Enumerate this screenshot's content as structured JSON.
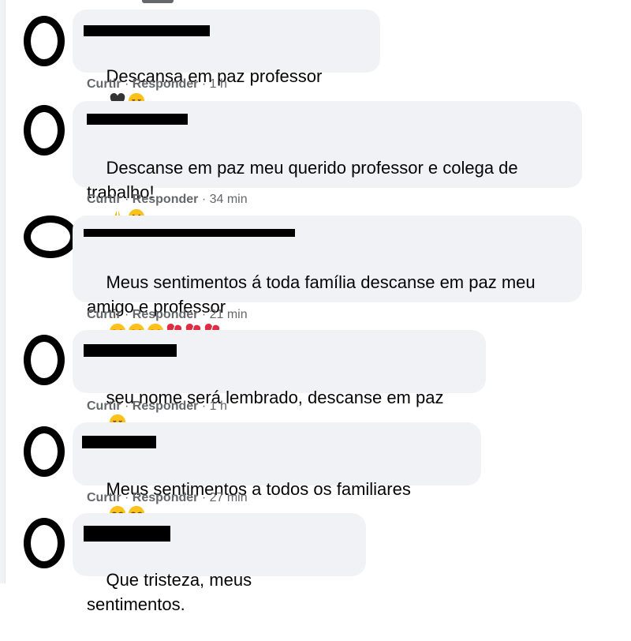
{
  "comments": [
    {
      "text": "Descansa em paz professor",
      "emojis": [
        "black-heart-icon",
        "pensive-face-icon"
      ],
      "like": "Curtir",
      "reply": "Responder",
      "time": "1 h"
    },
    {
      "text": "Descanse em paz meu querido professor e colega de trabalho!",
      "emojis": [
        "folded-hands-icon",
        "sad-face-icon"
      ],
      "like": "Curtir",
      "reply": "Responder",
      "time": "34 min"
    },
    {
      "text": "Meus sentimentos á toda família descanse em paz meu amigo e professor",
      "emojis": [
        "crying-face-icon",
        "crying-face-icon",
        "crying-face-icon",
        "broken-heart-icon",
        "broken-heart-icon",
        "broken-heart-icon"
      ],
      "like": "Curtir",
      "reply": "Responder",
      "time": "21 min"
    },
    {
      "text": "seu nome será lembrado, descanse em paz",
      "emojis": [
        "pensive-face-icon"
      ],
      "like": "Curtir",
      "reply": "Responder",
      "time": "1 h"
    },
    {
      "text": "Meus sentimentos a todos os familiares",
      "emojis": [
        "crying-face-icon",
        "crying-face-icon"
      ],
      "like": "Curtir",
      "reply": "Responder",
      "time": "27 min"
    },
    {
      "text": "Que tristeza, meus sentimentos.",
      "emojis": []
    }
  ],
  "separator": "·",
  "colors": {
    "bubble": "#f0f2f5",
    "meta": "#65676b",
    "text": "#050505",
    "redaction": "#000000"
  }
}
